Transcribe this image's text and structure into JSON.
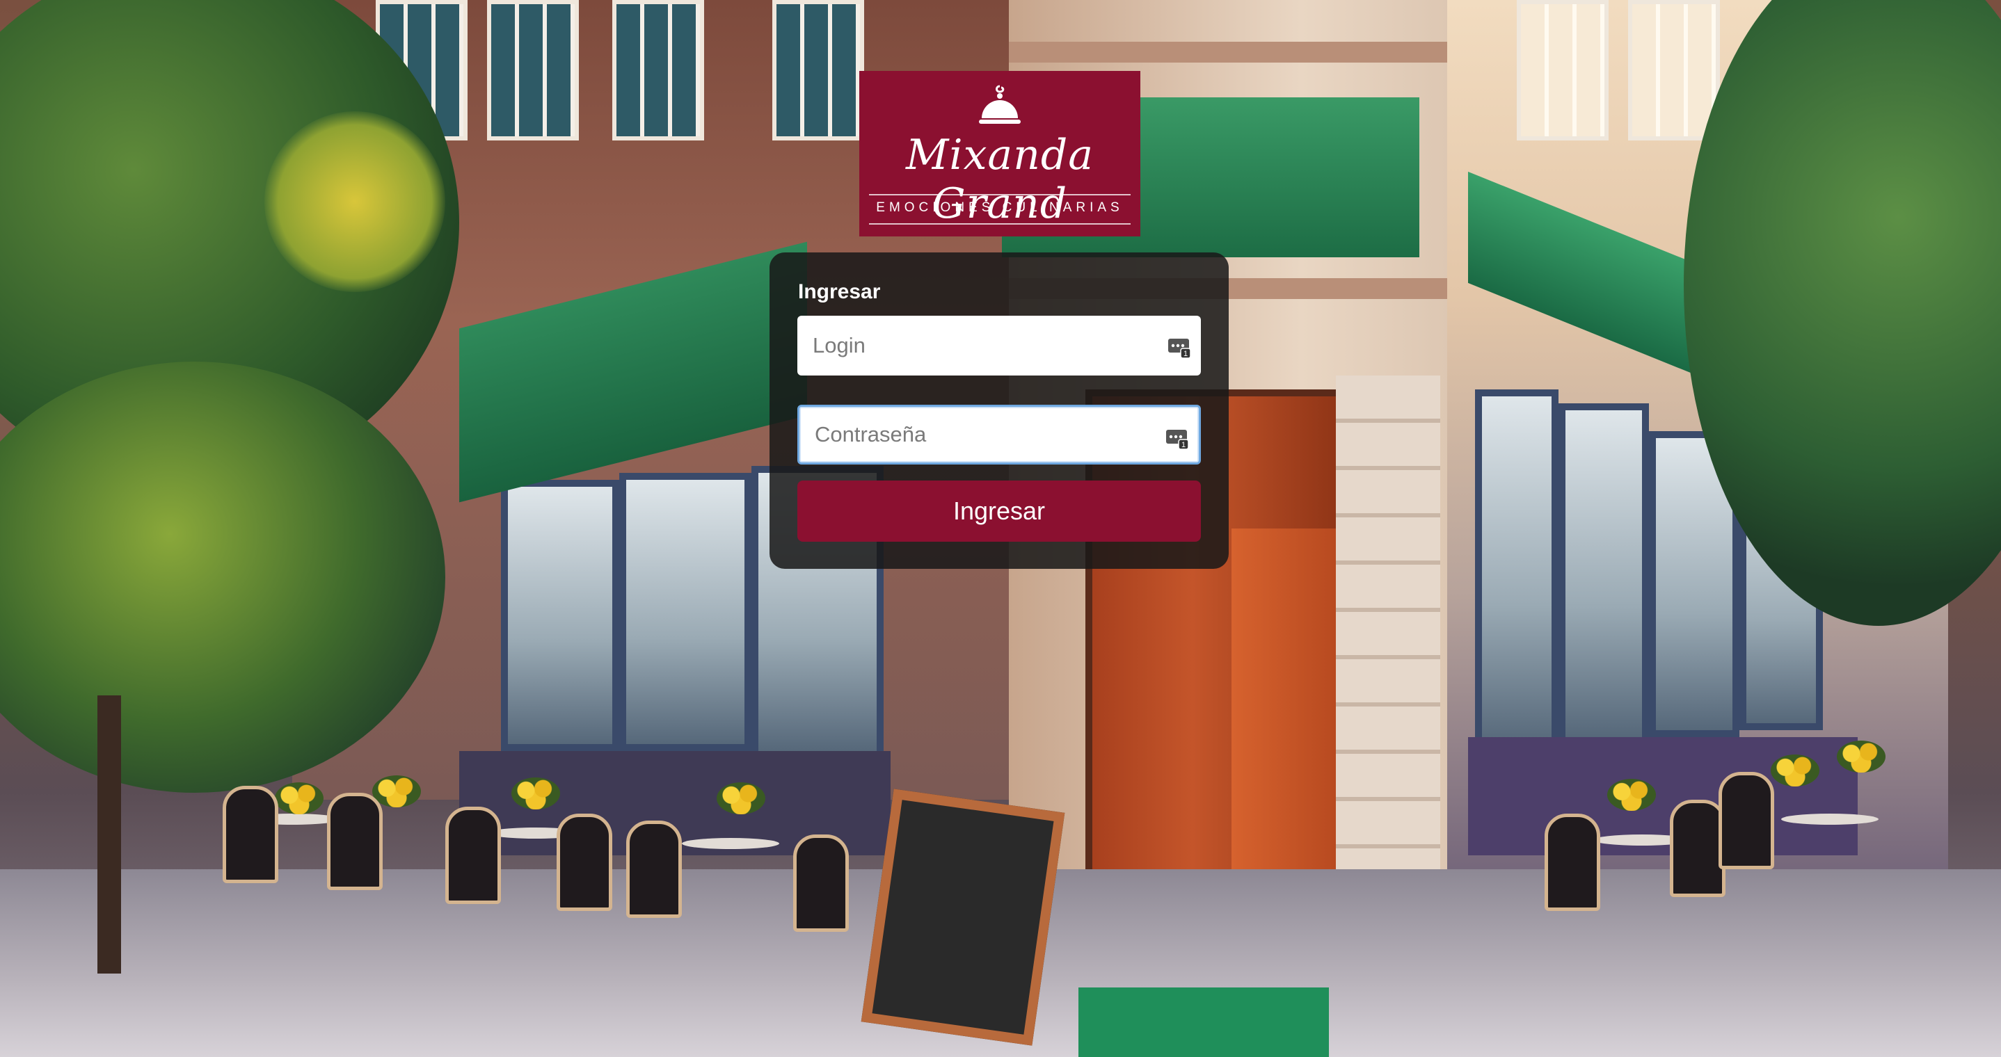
{
  "brand": {
    "name": "Mixanda Grand",
    "tagline": "EMOCIONES CULINARIAS",
    "color": "#8b1030"
  },
  "login_form": {
    "title": "Ingresar",
    "login_field": {
      "placeholder": "Login",
      "value": "",
      "icon": "credentials-autofill-icon"
    },
    "password_field": {
      "placeholder": "Contraseña",
      "value": "",
      "icon": "credentials-autofill-icon",
      "focused": true
    },
    "submit_label": "Ingresar"
  },
  "background": {
    "icon": "restaurant-street-scene-illustration"
  }
}
